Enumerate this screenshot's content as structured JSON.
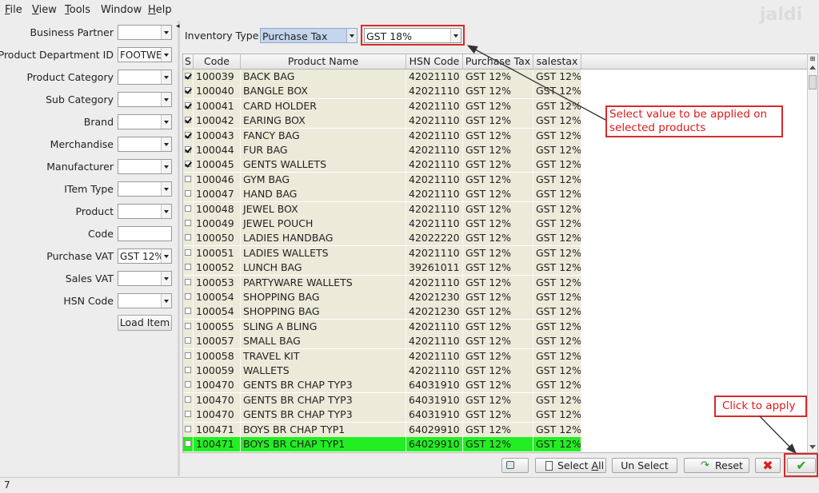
{
  "app": {
    "logo_text": "jaldi"
  },
  "menu": [
    {
      "mnemonic": "F",
      "rest": "ile"
    },
    {
      "mnemonic": "V",
      "rest": "iew"
    },
    {
      "mnemonic": "T",
      "rest": "ools"
    },
    {
      "mnemonic": "",
      "rest": "Window"
    },
    {
      "mnemonic": "H",
      "rest": "elp"
    }
  ],
  "filters": [
    {
      "label": "Business Partner",
      "type": "combo",
      "value": ""
    },
    {
      "label": "Product Department ID",
      "type": "combo",
      "value": "FOOTWEAR"
    },
    {
      "label": "Product Category",
      "type": "combo",
      "value": ""
    },
    {
      "label": "Sub Category",
      "type": "combo",
      "value": ""
    },
    {
      "label": "Brand",
      "type": "combo",
      "value": ""
    },
    {
      "label": "Merchandise",
      "type": "combo",
      "value": ""
    },
    {
      "label": "Manufacturer",
      "type": "combo",
      "value": ""
    },
    {
      "label": "ITem Type",
      "type": "combo",
      "value": ""
    },
    {
      "label": "Product",
      "type": "combo",
      "value": ""
    },
    {
      "label": "Code",
      "type": "text",
      "value": ""
    },
    {
      "label": "Purchase VAT",
      "type": "combo",
      "value": "GST 12%"
    },
    {
      "label": "Sales VAT",
      "type": "combo",
      "value": ""
    },
    {
      "label": "HSN Code",
      "type": "combo",
      "value": ""
    }
  ],
  "load_item_label": "Load Item",
  "inventory": {
    "label": "Inventory Type",
    "type_value": "Purchase Tax",
    "tax_value": "GST 18%"
  },
  "grid": {
    "headers": [
      "S",
      "Code",
      "Product Name",
      "HSN Code",
      "Purchase Tax",
      "salestax"
    ],
    "rows": [
      {
        "checked": true,
        "code": "100039",
        "name": "BACK BAG",
        "hsn": "42021110",
        "ptax": "GST 12%",
        "stax": "GST 12%"
      },
      {
        "checked": true,
        "code": "100040",
        "name": "BANGLE BOX",
        "hsn": "42021110",
        "ptax": "GST 12%",
        "stax": "GST 12%"
      },
      {
        "checked": true,
        "code": "100041",
        "name": "CARD HOLDER",
        "hsn": "42021110",
        "ptax": "GST 12%",
        "stax": "GST 12%"
      },
      {
        "checked": true,
        "code": "100042",
        "name": "EARING BOX",
        "hsn": "42021110",
        "ptax": "GST 12%",
        "stax": "GST 12%"
      },
      {
        "checked": true,
        "code": "100043",
        "name": "FANCY BAG",
        "hsn": "42021110",
        "ptax": "GST 12%",
        "stax": "GST 12%"
      },
      {
        "checked": true,
        "code": "100044",
        "name": "FUR BAG",
        "hsn": "42021110",
        "ptax": "GST 12%",
        "stax": "GST 12%"
      },
      {
        "checked": true,
        "code": "100045",
        "name": "GENTS WALLETS",
        "hsn": "42021110",
        "ptax": "GST 12%",
        "stax": "GST 12%"
      },
      {
        "checked": false,
        "code": "100046",
        "name": "GYM BAG",
        "hsn": "42021110",
        "ptax": "GST 12%",
        "stax": "GST 12%"
      },
      {
        "checked": false,
        "code": "100047",
        "name": "HAND BAG",
        "hsn": "42021110",
        "ptax": "GST 12%",
        "stax": "GST 12%"
      },
      {
        "checked": false,
        "code": "100048",
        "name": "JEWEL BOX",
        "hsn": "42021110",
        "ptax": "GST 12%",
        "stax": "GST 12%"
      },
      {
        "checked": false,
        "code": "100049",
        "name": "JEWEL POUCH",
        "hsn": "42021110",
        "ptax": "GST 12%",
        "stax": "GST 12%"
      },
      {
        "checked": false,
        "code": "100050",
        "name": "LADIES HANDBAG",
        "hsn": "42022220",
        "ptax": "GST 12%",
        "stax": "GST 12%"
      },
      {
        "checked": false,
        "code": "100051",
        "name": "LADIES WALLETS",
        "hsn": "42021110",
        "ptax": "GST 12%",
        "stax": "GST 12%"
      },
      {
        "checked": false,
        "code": "100052",
        "name": "LUNCH BAG",
        "hsn": "39261011",
        "ptax": "GST 12%",
        "stax": "GST 12%"
      },
      {
        "checked": false,
        "code": "100053",
        "name": "PARTYWARE WALLETS",
        "hsn": "42021110",
        "ptax": "GST 12%",
        "stax": "GST 12%"
      },
      {
        "checked": false,
        "code": "100054",
        "name": "SHOPPING BAG",
        "hsn": "42021230",
        "ptax": "GST 12%",
        "stax": "GST 12%"
      },
      {
        "checked": false,
        "code": "100054",
        "name": "SHOPPING BAG",
        "hsn": "42021230",
        "ptax": "GST 12%",
        "stax": "GST 12%"
      },
      {
        "checked": false,
        "code": "100055",
        "name": "SLING A BLING",
        "hsn": "42021110",
        "ptax": "GST 12%",
        "stax": "GST 12%"
      },
      {
        "checked": false,
        "code": "100057",
        "name": "SMALL BAG",
        "hsn": "42021110",
        "ptax": "GST 12%",
        "stax": "GST 12%"
      },
      {
        "checked": false,
        "code": "100058",
        "name": "TRAVEL KIT",
        "hsn": "42021110",
        "ptax": "GST 12%",
        "stax": "GST 12%"
      },
      {
        "checked": false,
        "code": "100059",
        "name": "WALLETS",
        "hsn": "42021110",
        "ptax": "GST 12%",
        "stax": "GST 12%"
      },
      {
        "checked": false,
        "code": "100470",
        "name": "GENTS BR CHAP TYP3",
        "hsn": "64031910",
        "ptax": "GST 12%",
        "stax": "GST 12%"
      },
      {
        "checked": false,
        "code": "100470",
        "name": "GENTS BR CHAP TYP3",
        "hsn": "64031910",
        "ptax": "GST 12%",
        "stax": "GST 12%"
      },
      {
        "checked": false,
        "code": "100470",
        "name": "GENTS BR CHAP TYP3",
        "hsn": "64031910",
        "ptax": "GST 12%",
        "stax": "GST 12%"
      },
      {
        "checked": false,
        "code": "100471",
        "name": "BOYS BR CHAP TYP1",
        "hsn": "64029910",
        "ptax": "GST 12%",
        "stax": "GST 12%"
      },
      {
        "checked": false,
        "code": "100471",
        "name": "BOYS BR CHAP TYP1",
        "hsn": "64029910",
        "ptax": "GST 12%",
        "stax": "GST 12%",
        "highlight": true
      }
    ]
  },
  "bottom": {
    "select_all_pre": "Select ",
    "select_all_mn": "A",
    "select_all_post": "ll",
    "unselect": "Un Select",
    "reset": "Reset"
  },
  "callouts": {
    "select_value": "Select value to be applied on selected products",
    "click_apply": "Click to apply"
  },
  "status": {
    "count": "7"
  },
  "colors": {
    "highlight_row": "#22ee22",
    "callout_red": "#d62b2b",
    "selected_combo": "#c4d5ee"
  }
}
